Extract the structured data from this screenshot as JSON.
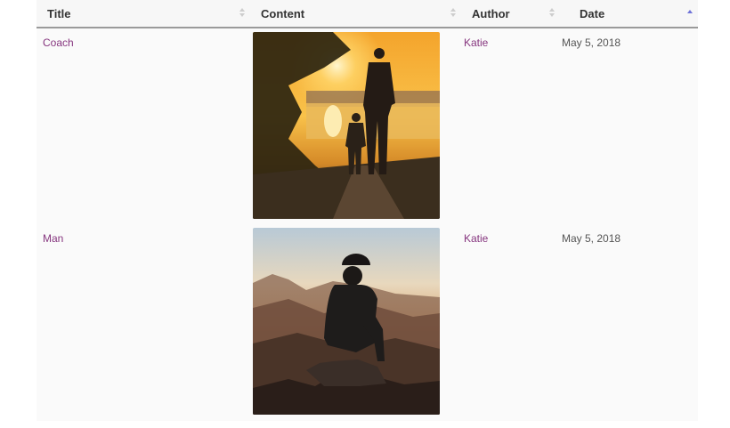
{
  "table": {
    "columns": [
      {
        "label": "Title"
      },
      {
        "label": "Content"
      },
      {
        "label": "Author"
      },
      {
        "label": "Date"
      }
    ],
    "sort": {
      "column": "Date",
      "direction": "ascending"
    },
    "rows": [
      {
        "title": "Coach",
        "image": "father-and-child-walking-at-sunset",
        "author": "Katie",
        "date": "May 5, 2018"
      },
      {
        "title": "Man",
        "image": "man-in-cap-sitting-on-mountain-at-sunset",
        "author": "Katie",
        "date": "May 5, 2018"
      }
    ]
  },
  "colors": {
    "link": "#86367f",
    "sort_active": "#6f73d8",
    "header_bg": "#f7f7f7",
    "row_bg": "#fafafa"
  }
}
